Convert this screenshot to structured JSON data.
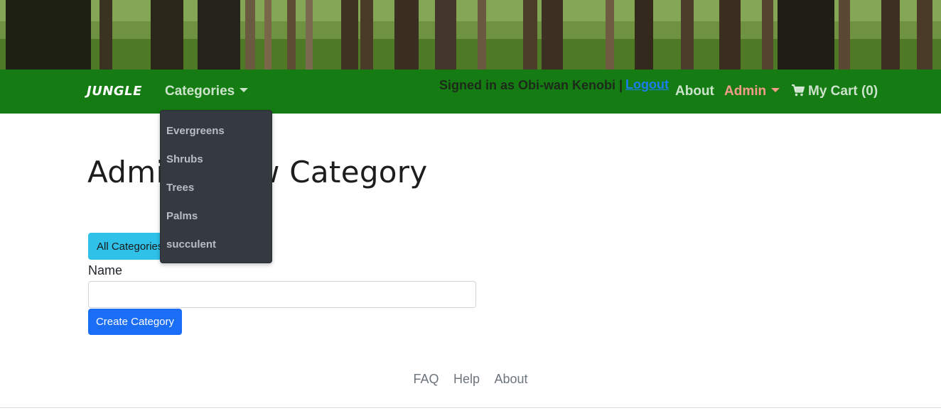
{
  "navbar": {
    "brand": "JUNGLE",
    "categories_label": "Categories",
    "signed_in_text": "Signed in as Obi-wan Kenobi |",
    "logout_label": "Logout",
    "about_label": "About",
    "admin_label": "Admin",
    "cart_label": "My Cart (0)",
    "cart_icon": "shopping-cart-icon",
    "colors": {
      "bar": "#157c14",
      "admin": "#f59b8a",
      "logout": "#1a7cf2"
    }
  },
  "dropdown": {
    "items": [
      "Evergreens",
      "Shrubs",
      "Trees",
      "Palms",
      "succulent"
    ]
  },
  "main": {
    "title": "Admin - New Category",
    "all_categories_label": "All Categories",
    "name_label": "Name",
    "name_value": "",
    "create_label": "Create Category"
  },
  "footer": {
    "links": [
      "FAQ",
      "Help",
      "About"
    ]
  }
}
